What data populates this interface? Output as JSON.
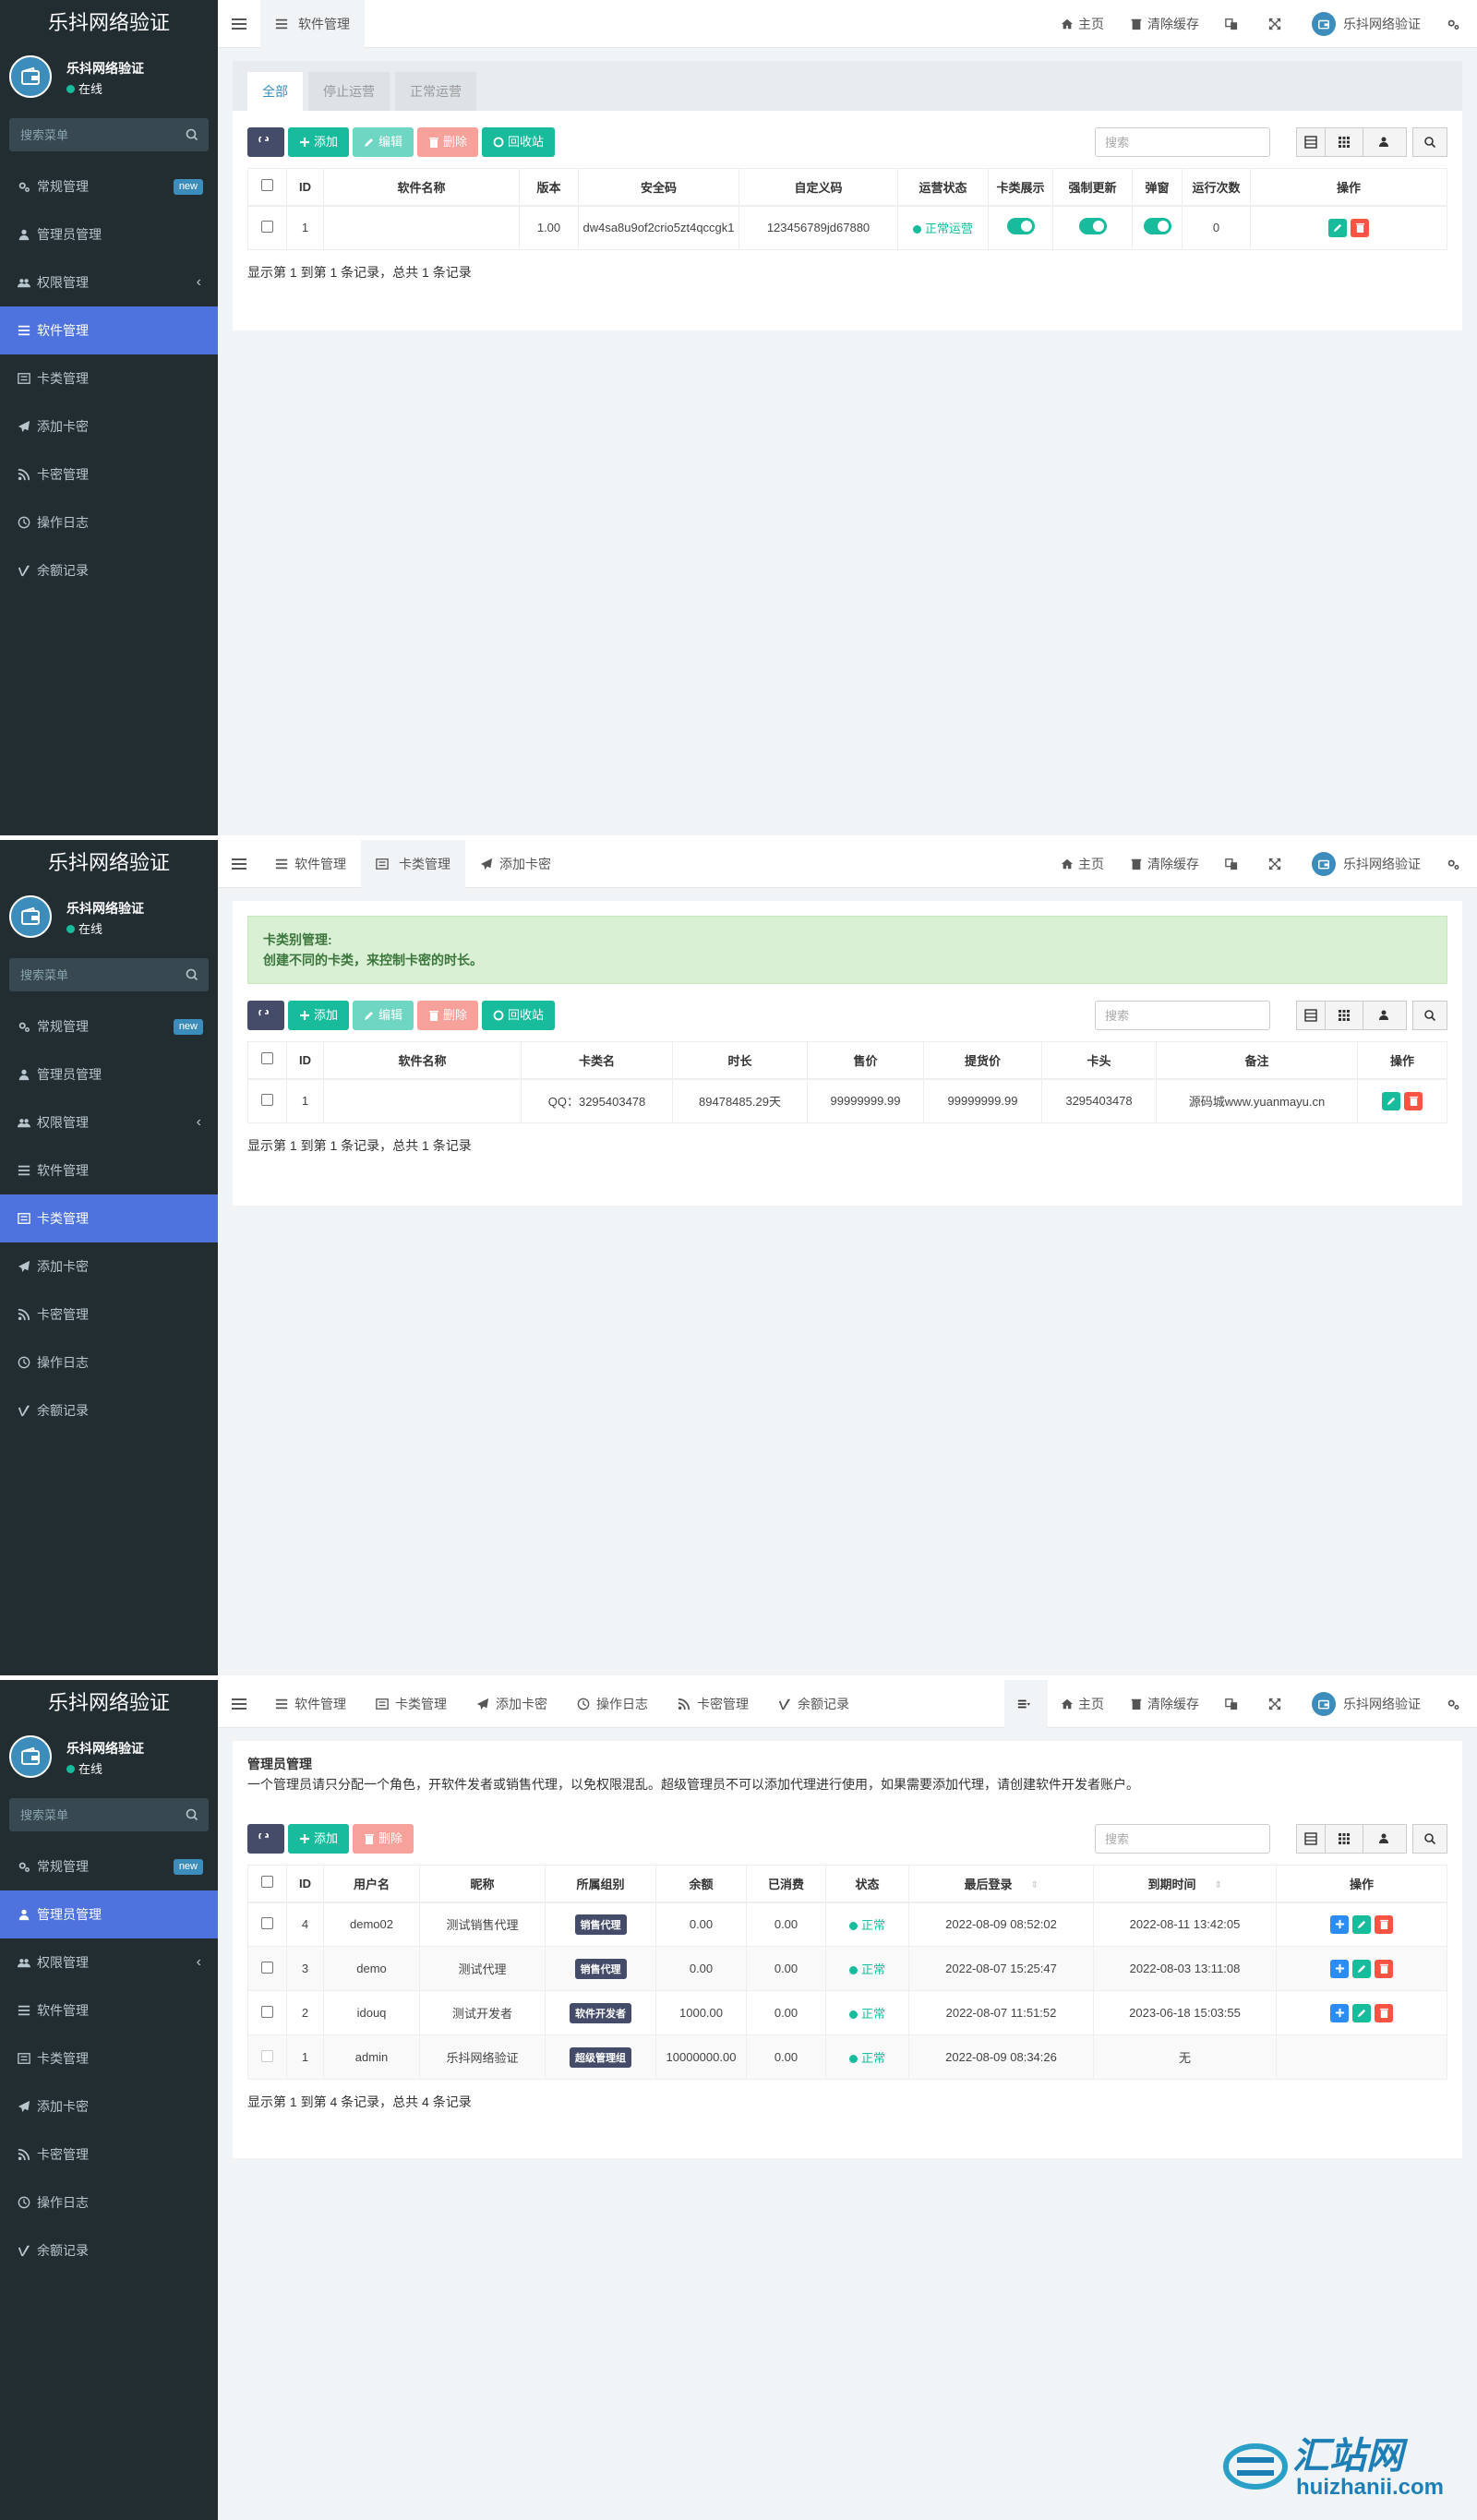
{
  "brand": "乐抖网络验证",
  "user": {
    "name": "乐抖网络验证",
    "status": "在线"
  },
  "sidebar": {
    "search_placeholder": "搜索菜单",
    "items": [
      {
        "label": "常规管理",
        "badge": "new"
      },
      {
        "label": "管理员管理"
      },
      {
        "label": "权限管理"
      },
      {
        "label": "软件管理"
      },
      {
        "label": "卡类管理"
      },
      {
        "label": "添加卡密"
      },
      {
        "label": "卡密管理"
      },
      {
        "label": "操作日志"
      },
      {
        "label": "余额记录"
      }
    ]
  },
  "topbar": {
    "home": "主页",
    "clear_cache": "清除缓存",
    "account": "乐抖网络验证",
    "tabs": {
      "software": "软件管理",
      "cardtype": "卡类管理",
      "addcard": "添加卡密",
      "oplog": "操作日志",
      "cardmgr": "卡密管理",
      "balance": "余额记录"
    }
  },
  "toolbar": {
    "add": "添加",
    "edit": "编辑",
    "delete": "删除",
    "recycle": "回收站",
    "search_placeholder": "搜索"
  },
  "software": {
    "tabs": [
      "全部",
      "停止运营",
      "正常运营"
    ],
    "columns": [
      "ID",
      "软件名称",
      "版本",
      "安全码",
      "自定义码",
      "运营状态",
      "卡类展示",
      "强制更新",
      "弹窗",
      "运行次数",
      "操作"
    ],
    "rows": [
      {
        "id": "1",
        "name": "",
        "version": "1.00",
        "safe": "dw4sa8u9of2crio5zt4qccgk1",
        "custom": "123456789jd67880",
        "status": "正常运营",
        "card_show": true,
        "force": true,
        "popup": true,
        "runs": "0"
      }
    ],
    "footer": "显示第 1 到第 1 条记录，总共 1 条记录"
  },
  "cardtype": {
    "alert_title": "卡类别管理:",
    "alert_text": "创建不同的卡类，来控制卡密的时长。",
    "columns": [
      "ID",
      "软件名称",
      "卡类名",
      "时长",
      "售价",
      "提货价",
      "卡头",
      "备注",
      "操作"
    ],
    "rows": [
      {
        "id": "1",
        "soft": "",
        "name": "QQ：3295403478",
        "duration": "89478485.29天",
        "price": "99999999.99",
        "pickup": "99999999.99",
        "head": "3295403478",
        "note": "源码城www.yuanmayu.cn"
      }
    ],
    "footer": "显示第 1 到第 1 条记录，总共 1 条记录"
  },
  "admin": {
    "title": "管理员管理",
    "desc": "一个管理员请只分配一个角色，开软件发者或销售代理，以免权限混乱。超级管理员不可以添加代理进行使用，如果需要添加代理，请创建软件开发者账户。",
    "columns": [
      "ID",
      "用户名",
      "昵称",
      "所属组别",
      "余额",
      "已消费",
      "状态",
      "最后登录",
      "到期时间",
      "操作"
    ],
    "rows": [
      {
        "id": "4",
        "user": "demo02",
        "nick": "测试销售代理",
        "group": "销售代理",
        "balance": "0.00",
        "spent": "0.00",
        "status": "正常",
        "last": "2022-08-09 08:52:02",
        "expire": "2022-08-11 13:42:05"
      },
      {
        "id": "3",
        "user": "demo",
        "nick": "测试代理",
        "group": "销售代理",
        "balance": "0.00",
        "spent": "0.00",
        "status": "正常",
        "last": "2022-08-07 15:25:47",
        "expire": "2022-08-03 13:11:08"
      },
      {
        "id": "2",
        "user": "idouq",
        "nick": "测试开发者",
        "group": "软件开发者",
        "balance": "1000.00",
        "spent": "0.00",
        "status": "正常",
        "last": "2022-08-07 11:51:52",
        "expire": "2023-06-18 15:03:55"
      },
      {
        "id": "1",
        "user": "admin",
        "nick": "乐抖网络验证",
        "group": "超级管理组",
        "balance": "10000000.00",
        "spent": "0.00",
        "status": "正常",
        "last": "2022-08-09 08:34:26",
        "expire": "无"
      }
    ],
    "footer": "显示第 1 到第 4 条记录，总共 4 条记录"
  },
  "watermark": {
    "cn": "汇站网",
    "en": "huizhanii.com"
  },
  "colors": {
    "sidebar": "#222d32",
    "active": "#4e73df",
    "green": "#18bc9c",
    "red": "#f75444",
    "dark": "#444c69"
  }
}
